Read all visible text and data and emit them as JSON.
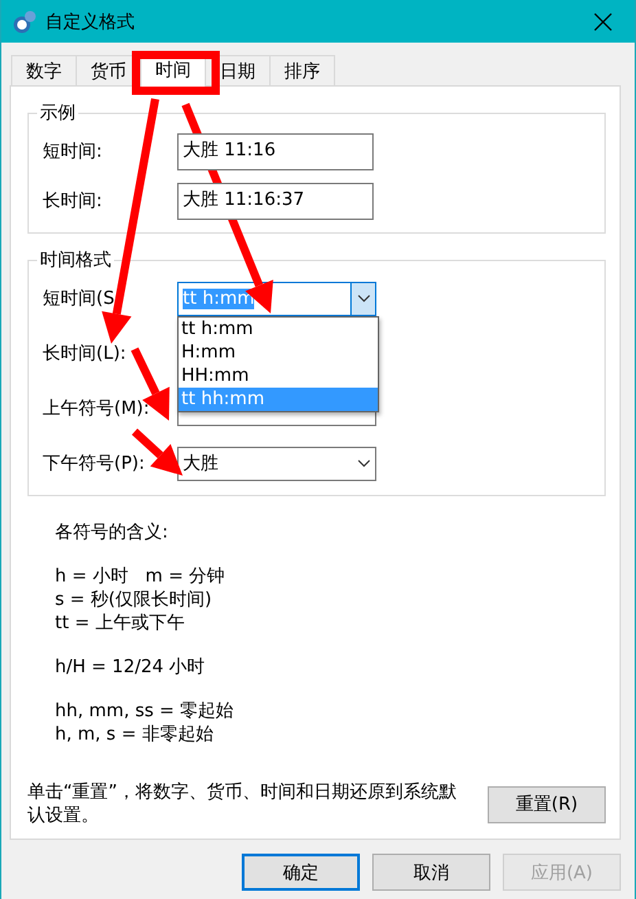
{
  "window": {
    "title": "自定义格式"
  },
  "tabs": [
    {
      "label": "数字",
      "selected": false
    },
    {
      "label": "货币",
      "selected": false
    },
    {
      "label": "时间",
      "selected": true
    },
    {
      "label": "日期",
      "selected": false
    },
    {
      "label": "排序",
      "selected": false
    }
  ],
  "sample": {
    "title": "示例",
    "rows": [
      {
        "label": "短时间:",
        "value": "大胜 11:16"
      },
      {
        "label": "长时间:",
        "value": "大胜 11:16:37"
      }
    ]
  },
  "format": {
    "title": "时间格式",
    "fields": [
      {
        "label": "短时间(S",
        "kind": "open",
        "value": "tt h:mm"
      },
      {
        "label": "长时间(L):",
        "kind": "hidden"
      },
      {
        "label": "上午符号(M):",
        "kind": "covered"
      },
      {
        "label": "下午符号(P):",
        "kind": "combo",
        "value": "大胜"
      }
    ],
    "dropdown": [
      {
        "text": "tt h:mm",
        "selected": false
      },
      {
        "text": "H:mm",
        "selected": false
      },
      {
        "text": "HH:mm",
        "selected": false
      },
      {
        "text": "tt hh:mm",
        "selected": true
      }
    ]
  },
  "legend": [
    [
      "各符号的含义:"
    ],
    [
      "h = 小时   m = 分钟",
      "s = 秒(仅限长时间)",
      "tt = 上午或下午"
    ],
    [
      "h/H = 12/24 小时"
    ],
    [
      "hh, mm, ss = 零起始",
      "h, m, s = 非零起始"
    ]
  ],
  "reset": {
    "note": "单击“重置”，将数字、货币、时间和日期还原到系统默认设置。",
    "button": "重置(R)"
  },
  "buttons": [
    {
      "label": "确定",
      "default": true,
      "disabled": false
    },
    {
      "label": "取消",
      "default": false,
      "disabled": false
    },
    {
      "label": "应用(A)",
      "default": false,
      "disabled": true
    }
  ]
}
